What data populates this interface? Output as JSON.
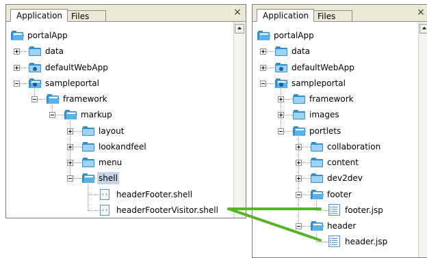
{
  "colors": {
    "selection": "#c5d4e6",
    "connector": "#58b32a",
    "folder": "#2f8fd0",
    "tab_bar": "#ece9d8"
  },
  "left_panel": {
    "tabs": [
      "Application",
      "Files"
    ],
    "close_glyph": "×",
    "tree": [
      {
        "label": "portalApp",
        "icon": "folder-open-icon",
        "level": 0,
        "expander": "none"
      },
      {
        "label": "data",
        "icon": "folder-closed-icon",
        "level": 1,
        "expander": "plus"
      },
      {
        "label": "defaultWebApp",
        "icon": "webapp-folder-icon",
        "level": 1,
        "expander": "plus"
      },
      {
        "label": "sampleportal",
        "icon": "webapp-folder-open-icon",
        "level": 1,
        "expander": "minus"
      },
      {
        "label": "framework",
        "icon": "folder-open-icon",
        "level": 2,
        "expander": "minus"
      },
      {
        "label": "markup",
        "icon": "folder-open-icon",
        "level": 3,
        "expander": "minus"
      },
      {
        "label": "layout",
        "icon": "folder-closed-icon",
        "level": 4,
        "expander": "plus"
      },
      {
        "label": "lookandfeel",
        "icon": "folder-closed-icon",
        "level": 4,
        "expander": "plus"
      },
      {
        "label": "menu",
        "icon": "folder-closed-icon",
        "level": 4,
        "expander": "plus"
      },
      {
        "label": "shell",
        "icon": "folder-open-icon",
        "level": 4,
        "expander": "minus",
        "selected": true
      },
      {
        "label": "headerFooter.shell",
        "icon": "shell-file-icon",
        "level": 5,
        "expander": "none"
      },
      {
        "label": "headerFooterVisitor.shell",
        "icon": "shell-file-icon",
        "level": 5,
        "expander": "none"
      }
    ]
  },
  "right_panel": {
    "tabs": [
      "Application",
      "Files"
    ],
    "close_glyph": "×",
    "tree": [
      {
        "label": "portalApp",
        "icon": "folder-open-icon",
        "level": 0,
        "expander": "none"
      },
      {
        "label": "data",
        "icon": "folder-closed-icon",
        "level": 1,
        "expander": "plus"
      },
      {
        "label": "defaultWebApp",
        "icon": "webapp-folder-icon",
        "level": 1,
        "expander": "plus"
      },
      {
        "label": "sampleportal",
        "icon": "webapp-folder-open-icon",
        "level": 1,
        "expander": "minus"
      },
      {
        "label": "framework",
        "icon": "folder-closed-icon",
        "level": 2,
        "expander": "plus"
      },
      {
        "label": "images",
        "icon": "folder-closed-icon",
        "level": 2,
        "expander": "plus"
      },
      {
        "label": "portlets",
        "icon": "folder-open-icon",
        "level": 2,
        "expander": "minus"
      },
      {
        "label": "collaboration",
        "icon": "folder-closed-icon",
        "level": 3,
        "expander": "plus"
      },
      {
        "label": "content",
        "icon": "folder-closed-icon",
        "level": 3,
        "expander": "plus"
      },
      {
        "label": "dev2dev",
        "icon": "folder-closed-icon",
        "level": 3,
        "expander": "plus"
      },
      {
        "label": "footer",
        "icon": "folder-open-icon",
        "level": 3,
        "expander": "minus"
      },
      {
        "label": "footer.jsp",
        "icon": "jsp-file-icon",
        "level": 4,
        "expander": "none"
      },
      {
        "label": "header",
        "icon": "folder-open-icon",
        "level": 3,
        "expander": "minus"
      },
      {
        "label": "header.jsp",
        "icon": "jsp-file-icon",
        "level": 4,
        "expander": "none"
      }
    ]
  }
}
